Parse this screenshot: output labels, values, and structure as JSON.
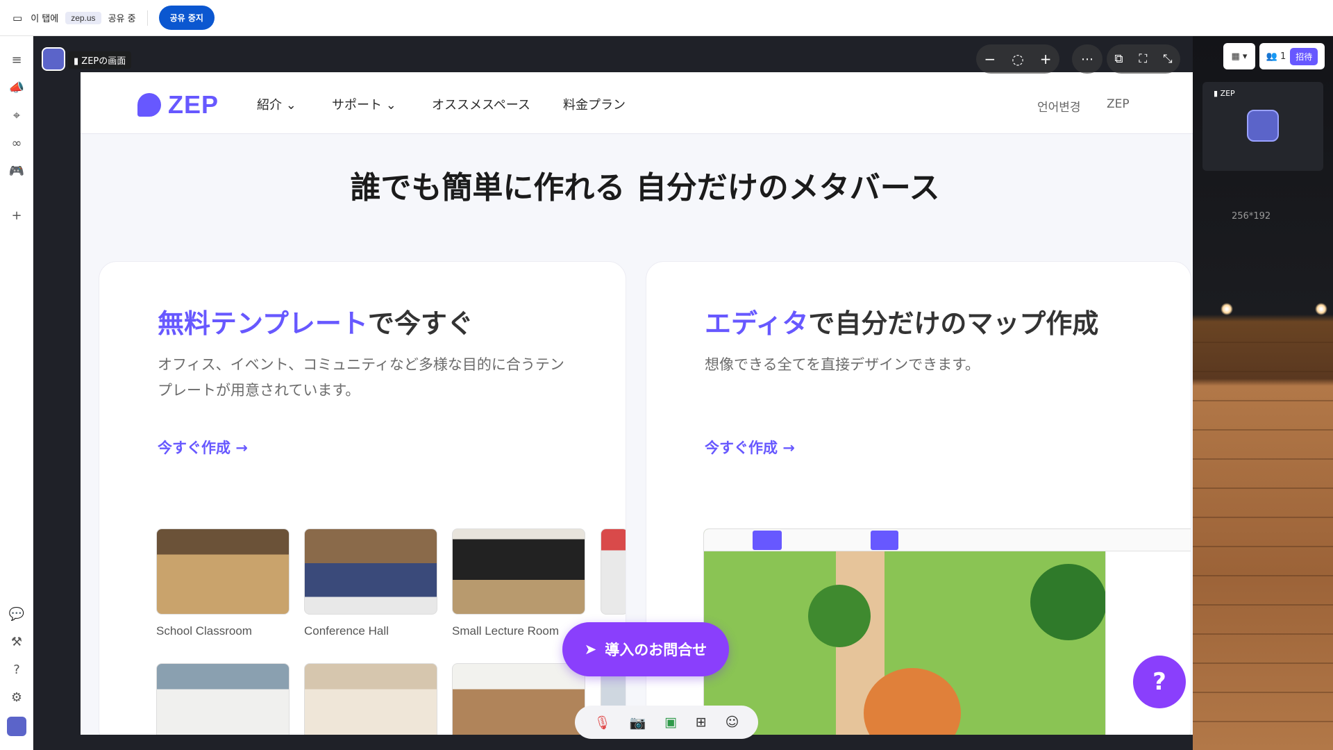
{
  "share_bar": {
    "prefix": "이 탭에",
    "domain": "zep.us",
    "suffix": "공유 중",
    "stop_label": "공유 중지"
  },
  "screen_share": {
    "label": "ZEPの画面"
  },
  "site": {
    "logo": "ZEP",
    "nav": [
      "紹介",
      "サポート",
      "オススメスペース",
      "料金プラン"
    ],
    "lang_ghost": "언어변경",
    "zep_ghost": "ZEP",
    "headline": "誰でも簡単に作れる 自分だけのメタバース",
    "card_left": {
      "title_accent": "無料テンプレート",
      "title_rest": "で今すぐ",
      "desc": "オフィス、イベント、コミュニティなど多様な目的に合うテンプレートが用意されています。",
      "cta": "今すぐ作成",
      "templates": [
        "School Classroom",
        "Conference Hall",
        "Small Lecture Room"
      ]
    },
    "card_right": {
      "title_accent": "エディタ",
      "title_rest": "で自分だけのマップ作成",
      "desc": "想像できる全てを直接デザインできます。",
      "cta": "今すぐ作成"
    },
    "contact_button": "導入のお問合せ",
    "help_button": "?"
  },
  "right_panel": {
    "participant_count": "1",
    "invite_label": "招待",
    "tile_label": "ZEP",
    "resolution": "256*192"
  },
  "icons": {
    "rail": [
      "menu-icon",
      "megaphone-icon",
      "location-pin-icon",
      "link-icon",
      "gamepad-icon",
      "plus-icon",
      "chat-icon",
      "hammer-icon",
      "help-icon",
      "settings-icon"
    ],
    "bottom": [
      "mic-off-icon",
      "camera-off-icon",
      "screen-share-icon",
      "apps-icon",
      "emoji-icon"
    ]
  },
  "colors": {
    "accent": "#6758ff",
    "contact": "#8a3ffc",
    "share_stop": "#0b57d0"
  }
}
